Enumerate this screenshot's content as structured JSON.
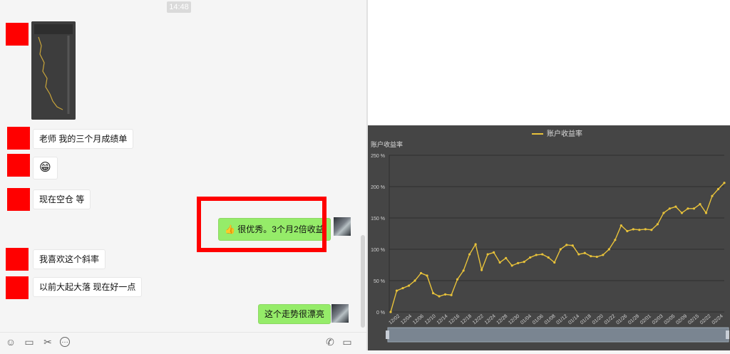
{
  "chat": {
    "timestamp": "14:48",
    "messages": [
      {
        "side": "left",
        "type": "image"
      },
      {
        "side": "left",
        "text": "老师 我的三个月成绩单"
      },
      {
        "side": "left",
        "text": "😁"
      },
      {
        "side": "left",
        "text": "现在空仓 等"
      },
      {
        "side": "right",
        "text": "👍 很优秀。3个月2倍收益"
      },
      {
        "side": "left",
        "text": "我喜欢这个斜率"
      },
      {
        "side": "left",
        "text": "以前大起大落 现在好一点"
      },
      {
        "side": "right",
        "text": "这个走势很漂亮"
      }
    ],
    "toolbar": {
      "emoji": "☺",
      "folder": "▭",
      "scissors": "✂",
      "chat": "…",
      "phone": "✆",
      "video": "▭"
    }
  },
  "colors": {
    "highlight": "#ff0000",
    "bubble_green": "#95ec69",
    "chart_bg": "#454545",
    "line": "#e8c23a"
  },
  "chart_data": {
    "type": "line",
    "title": "",
    "legend": "账户收益率",
    "legend_position": "top-center",
    "ylabel": "账户收益率",
    "grid": true,
    "ylim": [
      0,
      250
    ],
    "y_ticks": [
      "0 %",
      "50 %",
      "100 %",
      "150 %",
      "200 %",
      "250 %"
    ],
    "x_tick_labels": [
      "12/02",
      "12/04",
      "12/06",
      "12/10",
      "12/14",
      "12/16",
      "12/18",
      "12/22",
      "12/24",
      "12/28",
      "12/30",
      "01/04",
      "01/06",
      "01/08",
      "01/12",
      "01/14",
      "01/18",
      "01/20",
      "01/22",
      "01/26",
      "01/28",
      "02/01",
      "02/03",
      "02/05",
      "02/09",
      "02/15",
      "02/22",
      "02/24"
    ],
    "series": [
      {
        "name": "账户收益率",
        "values": [
          0,
          34,
          38,
          42,
          50,
          62,
          58,
          30,
          25,
          28,
          27,
          52,
          66,
          92,
          108,
          67,
          92,
          95,
          79,
          86,
          74,
          78,
          80,
          87,
          91,
          92,
          87,
          79,
          100,
          107,
          106,
          92,
          94,
          89,
          88,
          91,
          100,
          115,
          138,
          129,
          132,
          131,
          132,
          131,
          140,
          158,
          165,
          168,
          158,
          165,
          165,
          172,
          158,
          185,
          196,
          206
        ]
      }
    ]
  }
}
